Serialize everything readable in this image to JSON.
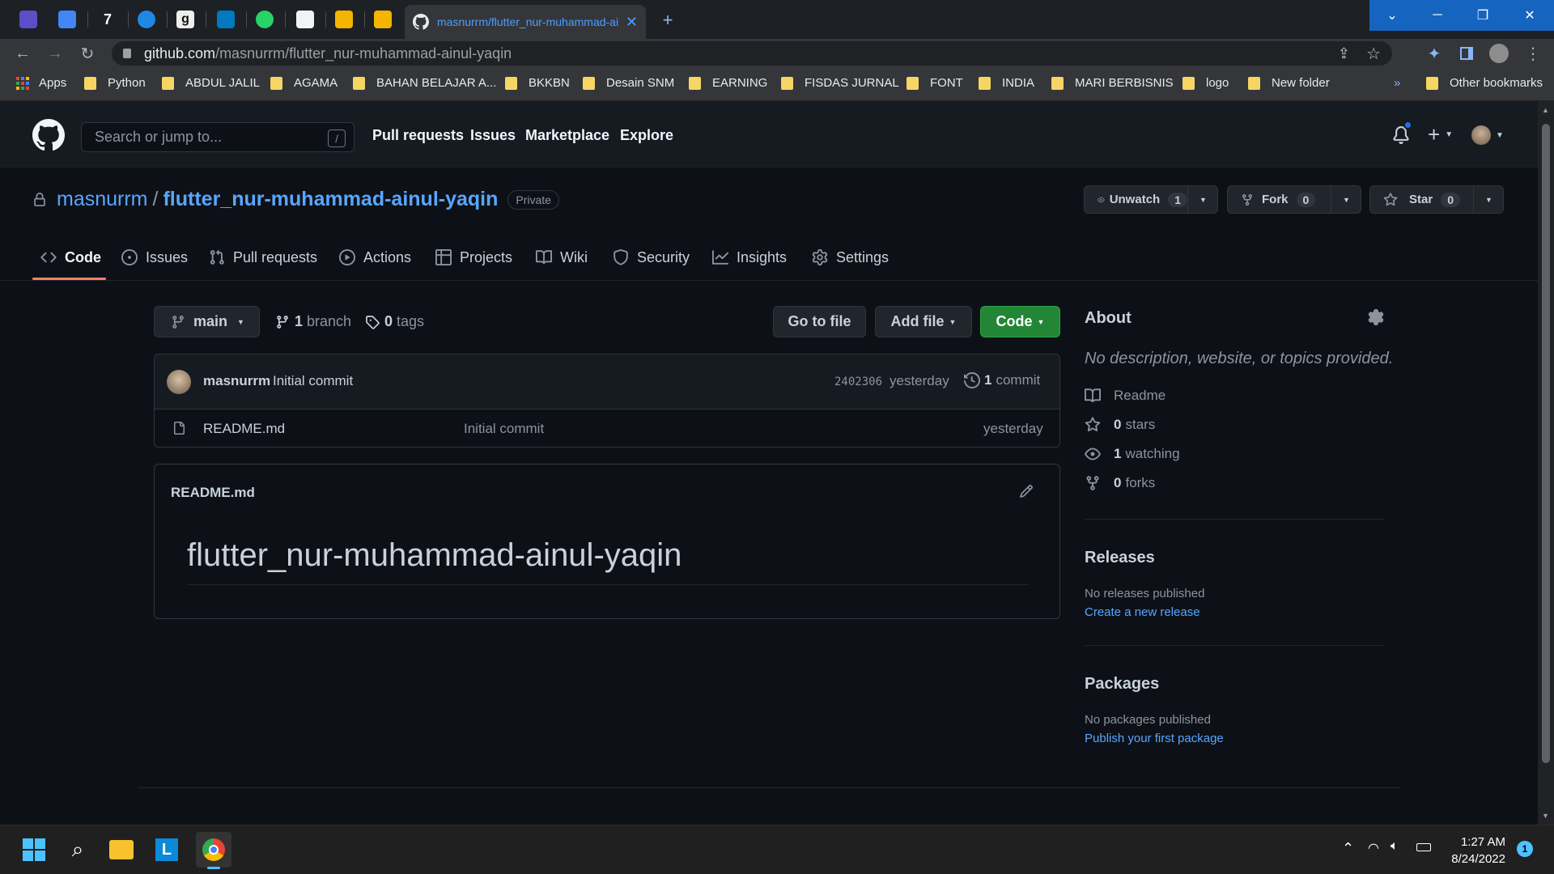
{
  "browser": {
    "active_tab_title": "masnurrm/flutter_nur-muhammad-ainul-yaqin",
    "url_host": "github.com",
    "url_path": "/masnurrm/flutter_nur-muhammad-ainul-yaqin",
    "bookmarks": [
      "Apps",
      "Python",
      "ABDUL JALIL",
      "AGAMA",
      "BAHAN BELAJAR A...",
      "BKKBN",
      "Desain SNM",
      "EARNING",
      "FISDAS JURNAL",
      "FONT",
      "INDIA",
      "MARI BERBISNIS",
      "logo",
      "New folder"
    ],
    "bookmarks_overflow": "»",
    "other_bookmarks": "Other bookmarks"
  },
  "github_header": {
    "search_placeholder": "Search or jump to...",
    "search_shortcut": "/",
    "nav": [
      "Pull requests",
      "Issues",
      "Marketplace",
      "Explore"
    ],
    "plus": "+"
  },
  "repo": {
    "owner": "masnurrm",
    "separator": "/",
    "name": "flutter_nur-muhammad-ainul-yaqin",
    "visibility": "Private",
    "unwatch_label": "Unwatch",
    "unwatch_count": "1",
    "fork_label": "Fork",
    "fork_count": "0",
    "star_label": "Star",
    "star_count": "0"
  },
  "tabs": [
    "Code",
    "Issues",
    "Pull requests",
    "Actions",
    "Projects",
    "Wiki",
    "Security",
    "Insights",
    "Settings"
  ],
  "files": {
    "branch": "main",
    "branch_count": "1",
    "branch_word": "branch",
    "tag_count": "0",
    "tag_word": "tags",
    "go_to_file": "Go to file",
    "add_file": "Add file",
    "code_button": "Code",
    "commit_author": "masnurrm",
    "commit_message": "Initial commit",
    "commit_hash": "2402306",
    "commit_time": "yesterday",
    "commit_count": "1",
    "commit_word": "commit",
    "rows": [
      {
        "name": "README.md",
        "message": "Initial commit",
        "time": "yesterday"
      }
    ]
  },
  "readme": {
    "filename": "README.md",
    "heading": "flutter_nur-muhammad-ainul-yaqin"
  },
  "about": {
    "title": "About",
    "description": "No description, website, or topics provided.",
    "readme": "Readme",
    "stars_count": "0",
    "stars_word": "stars",
    "watching_count": "1",
    "watching_word": "watching",
    "forks_count": "0",
    "forks_word": "forks"
  },
  "releases": {
    "title": "Releases",
    "empty": "No releases published",
    "link": "Create a new release"
  },
  "packages": {
    "title": "Packages",
    "empty": "No packages published",
    "link": "Publish your first package"
  },
  "taskbar": {
    "time": "1:27 AM",
    "date": "8/24/2022",
    "notification_count": "1"
  },
  "colors": {
    "accent_link": "#58a6ff",
    "code_button": "#238636",
    "tab_underline": "#f78166",
    "background": "#0d1117"
  }
}
